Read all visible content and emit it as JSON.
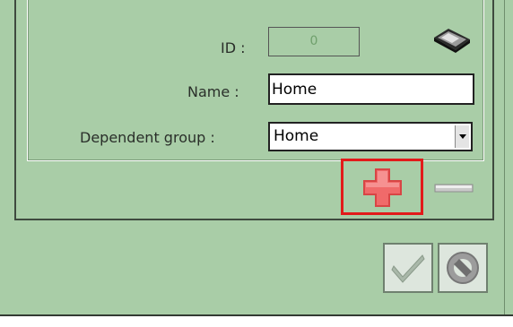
{
  "form": {
    "id_label": "ID :",
    "id_value": "0",
    "name_label": "Name :",
    "name_value": "Home",
    "group_label": "Dependent group :",
    "group_value": "Home"
  },
  "icons": {
    "storage": "storage-icon",
    "add": "plus-icon",
    "remove": "minus-icon",
    "confirm": "checkmark-icon",
    "cancel": "cancel-icon"
  },
  "colors": {
    "background": "#a9cda7",
    "highlight": "#e21a1a",
    "add_icon": "#f26f6f"
  }
}
